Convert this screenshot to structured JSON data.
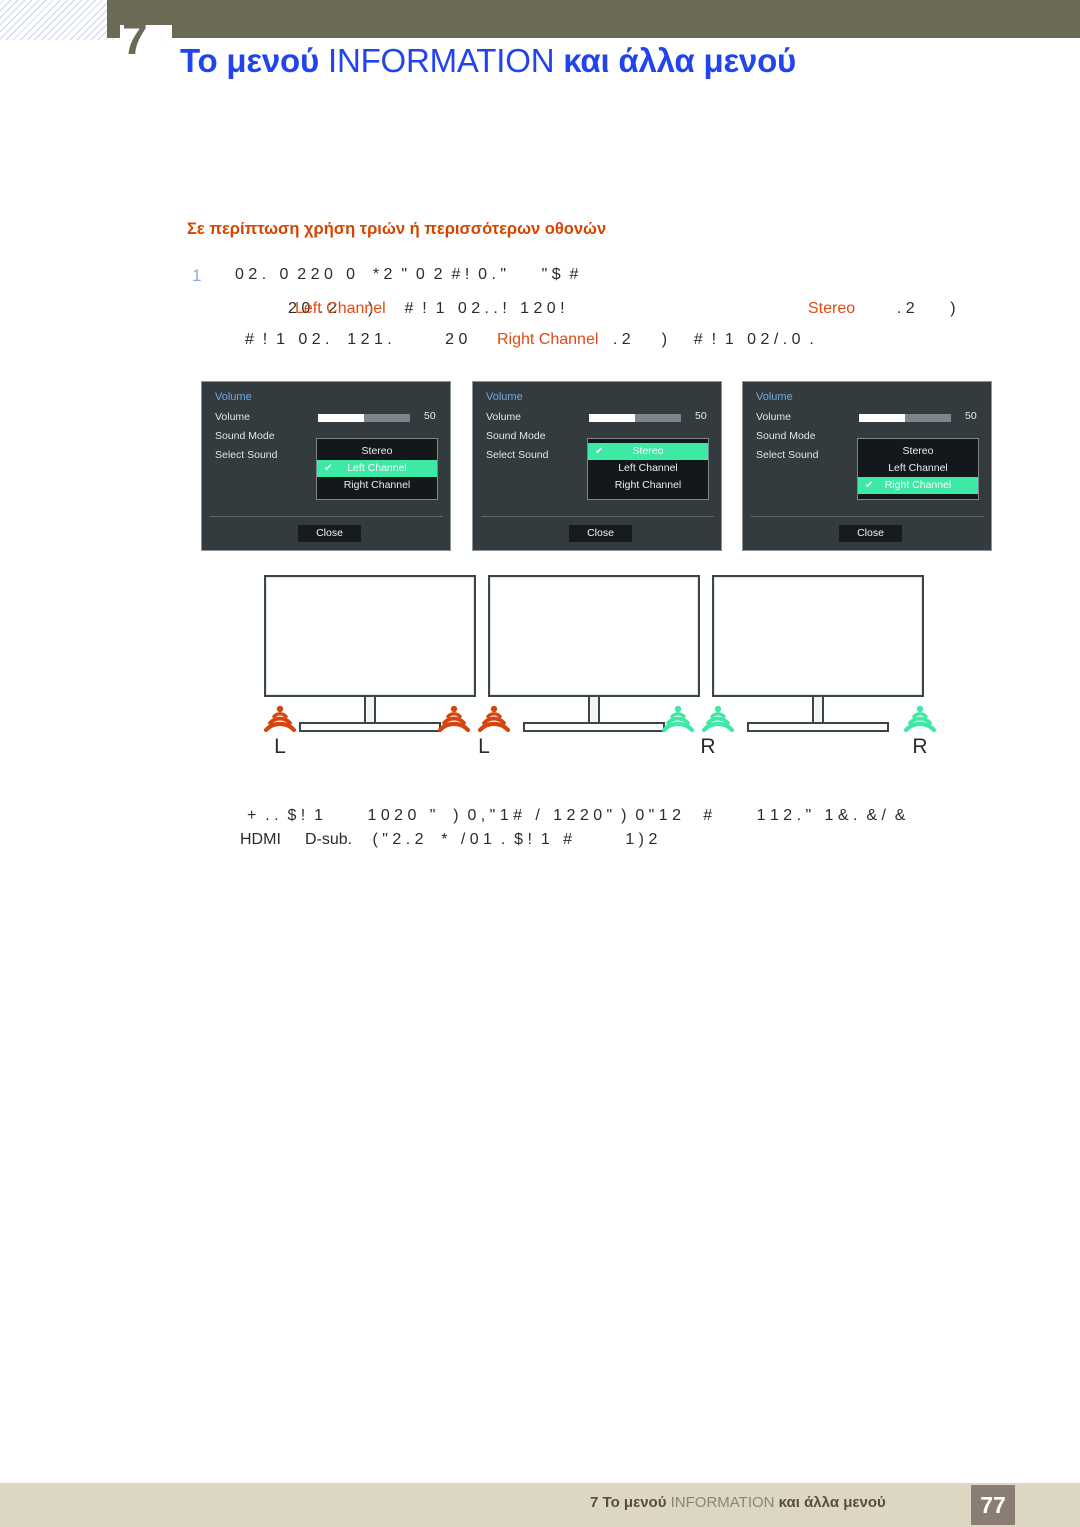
{
  "header": {
    "chapter_number": "7",
    "title_part1": "Το μενού ",
    "title_reg": "INFORMATION",
    "title_part2": " και άλλα μενού"
  },
  "section": {
    "heading": "Σε περίπτωση χρήση τριών ή περισσότερων οθονών",
    "step_number": "1"
  },
  "body": {
    "line1": "0 2 .   0  2 2 0   0    * 2  \"  0  2  # !  0 . \"        \" $  #",
    "line2_pre": "2 0",
    "line2_mid": "  . 2       )       #  !  1   0 2 . . !   1 2 0 !",
    "line2_post": "  . 2        )",
    "line3_pre": "#  !  1   0 2 .    1 2 1 .            2 0",
    "line3_post": "  . 2       )      #  !  1   0 2 / . 0  .",
    "highlight_left": "Left Channel",
    "highlight_stereo": "Stereo",
    "highlight_right": "Right Channel"
  },
  "note": {
    "line1": "+  . .  $ !  1          1 0 2 0   \"    )  0 , \" 1 #   /   1 2 2 0 \"  )  0 \" 1 2     #          1 1 2 . \"   1 & .  & /  &",
    "line2_prefix": "HDMI",
    "line2_mid": "D-sub.",
    "line2_rest": " ( \" 2 . 2    *   / 0 1  .  $ !  1   #            1 ) 2"
  },
  "osd_panels": [
    {
      "title": "Volume",
      "rows": [
        "Volume",
        "Sound Mode",
        "Select Sound"
      ],
      "slider_value": "50",
      "slider_percent": 50,
      "options": [
        "Stereo",
        "Left Channel",
        "Right Channel"
      ],
      "selected_index": 1,
      "check_glyph": "✔",
      "close_label": "Close"
    },
    {
      "title": "Volume",
      "rows": [
        "Volume",
        "Sound Mode",
        "Select Sound"
      ],
      "slider_value": "50",
      "slider_percent": 50,
      "options": [
        "Stereo",
        "Left Channel",
        "Right Channel"
      ],
      "selected_index": 0,
      "check_glyph": "✔",
      "close_label": "Close"
    },
    {
      "title": "Volume",
      "rows": [
        "Volume",
        "Sound Mode",
        "Select Sound"
      ],
      "slider_value": "50",
      "slider_percent": 50,
      "options": [
        "Stereo",
        "Left Channel",
        "Right Channel"
      ],
      "selected_index": 2,
      "check_glyph": "✔",
      "close_label": "Close"
    }
  ],
  "diagram": {
    "speakers": [
      {
        "label": "L",
        "color": "#d6450d"
      },
      {
        "label": "L",
        "color": "#d6450d"
      },
      {
        "label": "R",
        "color": "#3ee9a5"
      },
      {
        "label": "R",
        "color": "#3ee9a5"
      }
    ],
    "extra_speaker_color_left": "#d6450d",
    "extra_speaker_color_right": "#3ee9a5"
  },
  "footer": {
    "chapter": "7",
    "title_part1": "Το μενού ",
    "title_reg": "INFORMATION",
    "title_part2": " και άλλα μενού",
    "page_number": "77"
  },
  "colors": {
    "header_band": "#6b6a55",
    "title_blue": "#2244ee",
    "section_orange": "#d64500",
    "highlight_orange": "#e24a13",
    "osd_bg": "#333b3e",
    "osd_accent": "#3ee9a5",
    "footer_band": "#ddd6c3",
    "page_box": "#8b7d73"
  }
}
